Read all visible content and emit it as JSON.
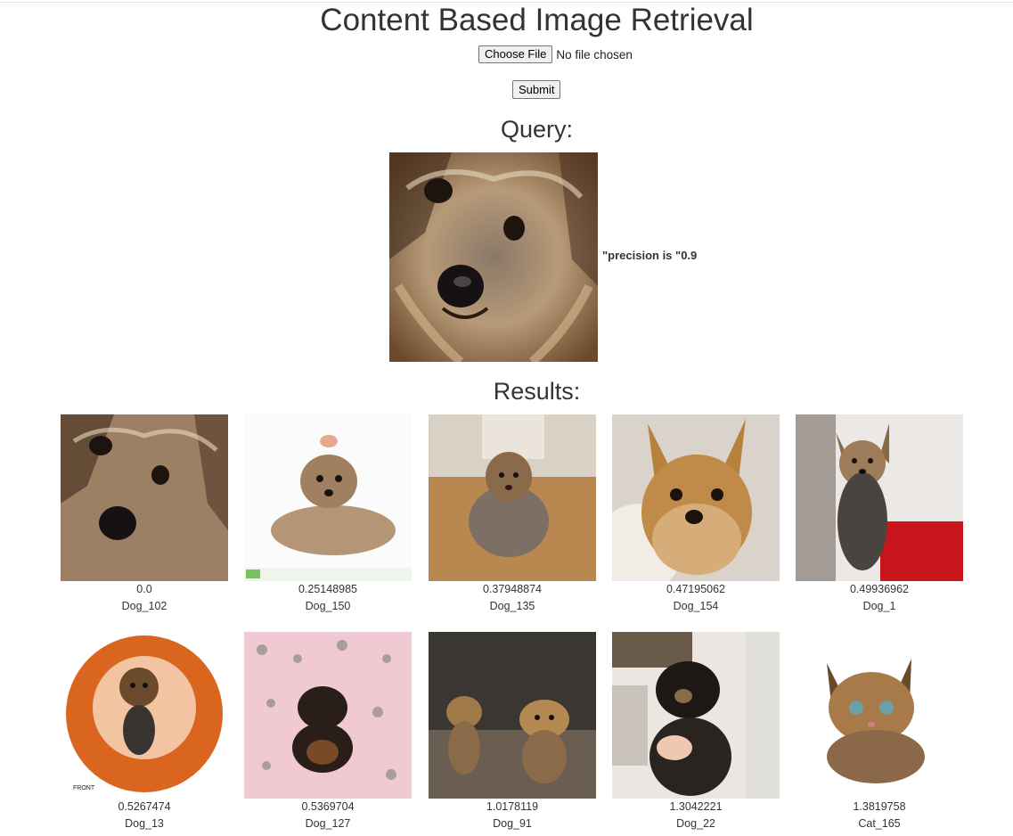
{
  "page": {
    "title": "Content Based Image Retrieval"
  },
  "form": {
    "choose_file_label": "Choose File",
    "file_status": "No file chosen",
    "submit_label": "Submit"
  },
  "query": {
    "heading": "Query:",
    "precision_text": "\"precision is \"0.9"
  },
  "results": {
    "heading": "Results:",
    "items": [
      {
        "score": "0.0",
        "label": "Dog_102"
      },
      {
        "score": "0.25148985",
        "label": "Dog_150"
      },
      {
        "score": "0.37948874",
        "label": "Dog_135"
      },
      {
        "score": "0.47195062",
        "label": "Dog_154"
      },
      {
        "score": "0.49936962",
        "label": "Dog_1"
      },
      {
        "score": "0.5267474",
        "label": "Dog_13"
      },
      {
        "score": "0.5369704",
        "label": "Dog_127"
      },
      {
        "score": "1.0178119",
        "label": "Dog_91"
      },
      {
        "score": "1.3042221",
        "label": "Dog_22"
      },
      {
        "score": "1.3819758",
        "label": "Cat_165"
      }
    ]
  }
}
